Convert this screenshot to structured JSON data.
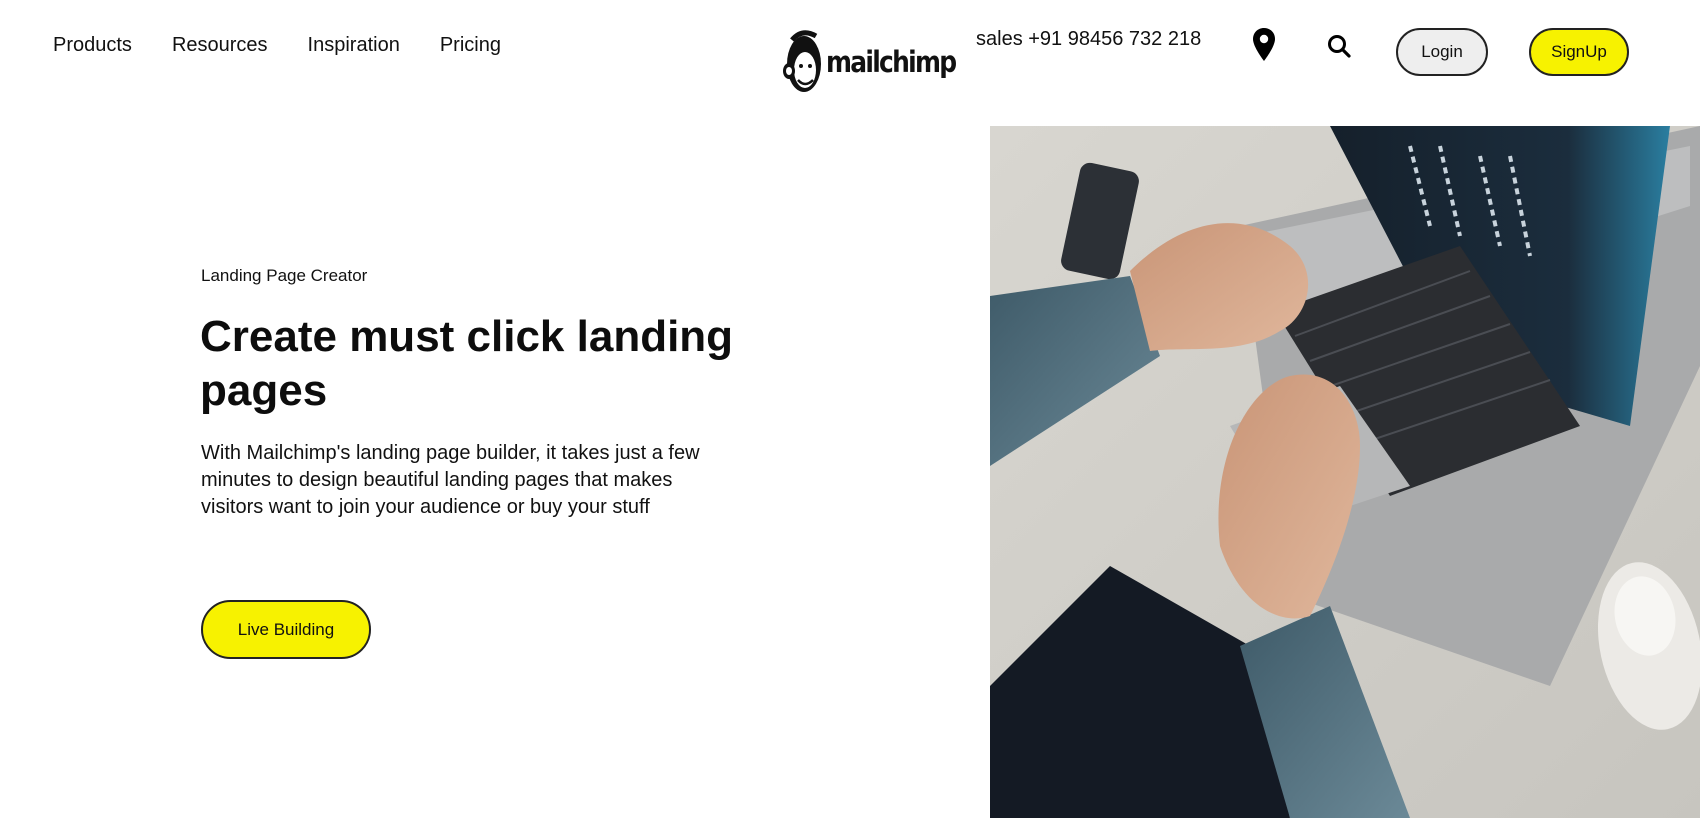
{
  "header": {
    "nav": [
      "Products",
      "Resources",
      "Inspiration",
      "Pricing"
    ],
    "logo_text": "mailchimp",
    "phone": "sales +91 98456 732 218",
    "login_label": "Login",
    "signup_label": "SignUp",
    "icons": {
      "location": "map-pin-icon",
      "search": "search-icon"
    }
  },
  "hero": {
    "eyebrow": "Landing Page Creator",
    "title": "Create must click landing pages",
    "description": "With Mailchimp's landing page builder, it takes just a few minutes to design beautiful landing pages that makes visitors want to join your audience or buy your stuff",
    "cta_label": "Live Building"
  },
  "colors": {
    "accent_yellow": "#f7f200",
    "login_bg": "#eeeeee",
    "text": "#111111"
  }
}
